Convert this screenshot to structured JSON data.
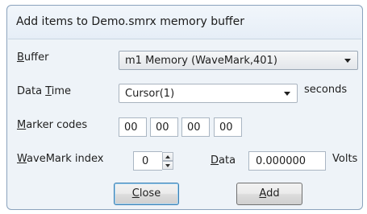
{
  "dialog": {
    "title": "Add items to Demo.smrx memory buffer"
  },
  "buffer": {
    "label_accel": "B",
    "label_rest": "uffer",
    "value": "m1 Memory (WaveMark,401)"
  },
  "data_time": {
    "label_pre": "Data ",
    "label_accel": "T",
    "label_post": "ime",
    "value": "Cursor(1)",
    "unit": "seconds"
  },
  "marker_codes": {
    "label_accel": "M",
    "label_rest": "arker codes",
    "values": [
      "00",
      "00",
      "00",
      "00"
    ]
  },
  "wavemark_index": {
    "label_accel": "W",
    "label_rest": "aveMark index",
    "value": "0"
  },
  "data_value": {
    "label_accel": "D",
    "label_rest": "ata",
    "value": "0.000000",
    "unit": "Volts"
  },
  "buttons": {
    "close_accel": "C",
    "close_rest": "lose",
    "add_accel": "A",
    "add_rest": "dd"
  }
}
